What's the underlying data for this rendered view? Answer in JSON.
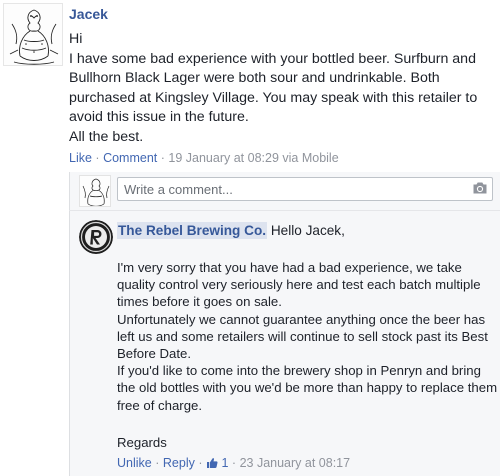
{
  "post": {
    "author": "Jacek",
    "lines": [
      "Hi",
      "I have some bad experience with your bottled beer. Surfburn and",
      "Bullhorn Black Lager were both sour and undrinkable. Both",
      "purchased at Kingsley Village. You may speak with this retailer to",
      "avoid this issue in the future.",
      "All the best."
    ],
    "actions": {
      "like": "Like",
      "comment": "Comment",
      "separator": "·",
      "timestamp": "19 January at 08:29 via Mobile"
    }
  },
  "comment_box": {
    "placeholder": "Write a comment...",
    "camera_icon": "camera-icon"
  },
  "reply": {
    "page_name": "The Rebel Brewing Co.",
    "greeting": "Hello Jacek,",
    "lines": [
      "I'm very sorry that you have had a bad experience, we take",
      "quality control very seriously here and test each batch multiple",
      "times before it goes on sale.",
      "Unfortunately we cannot guarantee anything once the beer has",
      "left us and some retailers will continue to sell stock past its Best",
      "Before Date.",
      "If you'd like to come into the brewery shop in Penryn and bring",
      "the old bottles with you we'd be more than happy to replace them",
      "free of charge."
    ],
    "closing": "Regards",
    "actions": {
      "unlike": "Unlike",
      "reply": "Reply",
      "separator": "·",
      "like_count": "1",
      "timestamp": "23 January at 08:17"
    }
  },
  "colors": {
    "link": "#4267b2",
    "page_name": "#365899",
    "meta_grey": "#90949c",
    "panel_bg": "#f6f7f9"
  }
}
